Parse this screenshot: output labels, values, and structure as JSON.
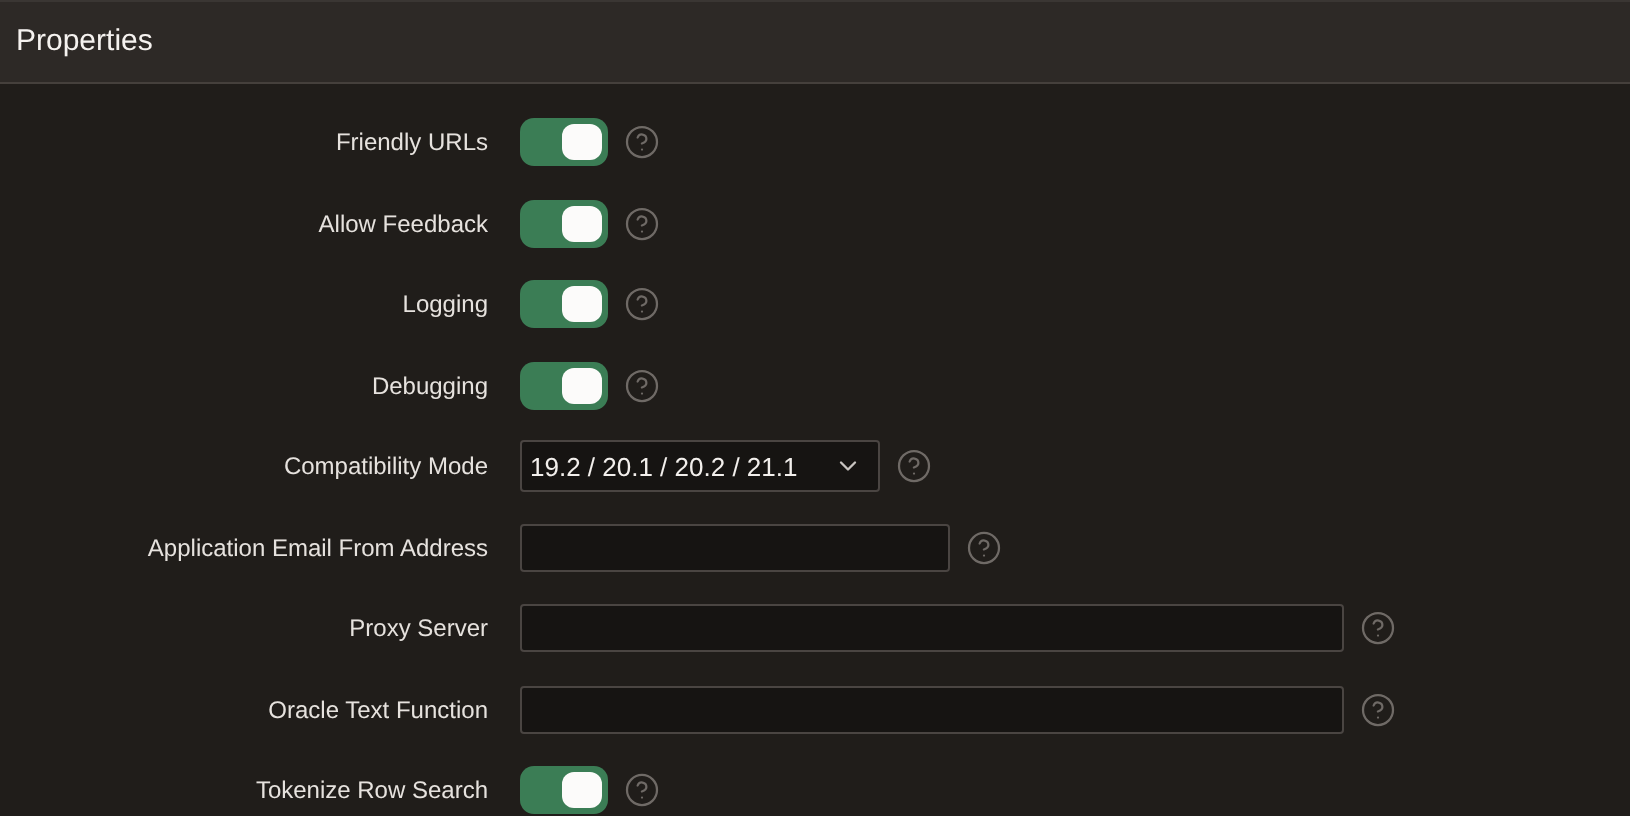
{
  "header": {
    "title": "Properties"
  },
  "fields": [
    {
      "label": "Friendly URLs",
      "kind": "switch",
      "on": true
    },
    {
      "label": "Allow Feedback",
      "kind": "switch",
      "on": true
    },
    {
      "label": "Logging",
      "kind": "switch",
      "on": true
    },
    {
      "label": "Debugging",
      "kind": "switch",
      "on": true
    },
    {
      "label": "Compatibility Mode",
      "kind": "select",
      "value": "19.2 / 20.1 / 20.2 / 21.1"
    },
    {
      "label": "Application Email From Address",
      "kind": "email"
    },
    {
      "label": "Proxy Server",
      "kind": "text"
    },
    {
      "label": "Oracle Text Function",
      "kind": "text"
    },
    {
      "label": "Tokenize Row Search",
      "kind": "switch",
      "on": true
    }
  ]
}
